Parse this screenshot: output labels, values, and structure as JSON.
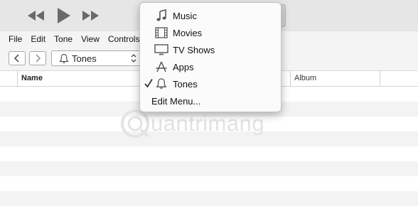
{
  "menubar": {
    "items": [
      "File",
      "Edit",
      "Tone",
      "View",
      "Controls"
    ]
  },
  "toolbar": {
    "media_selector": {
      "label": "Tones",
      "icon": "bell-icon"
    }
  },
  "table": {
    "columns": [
      "Name",
      "Album"
    ],
    "row_count": 9
  },
  "media_menu": {
    "items": [
      {
        "label": "Music",
        "icon": "music-note-icon",
        "checked": false
      },
      {
        "label": "Movies",
        "icon": "film-icon",
        "checked": false
      },
      {
        "label": "TV Shows",
        "icon": "tv-icon",
        "checked": false
      },
      {
        "label": "Apps",
        "icon": "app-store-icon",
        "checked": false
      },
      {
        "label": "Tones",
        "icon": "bell-icon",
        "checked": true
      }
    ],
    "edit_label": "Edit Menu..."
  },
  "watermark": {
    "text": "uantrimang"
  },
  "colors": {
    "player_bar": "#e6e6e6",
    "menu_bg": "#fbfbfb",
    "stripe": "#f3f3f3",
    "icon_gray": "#555555"
  }
}
